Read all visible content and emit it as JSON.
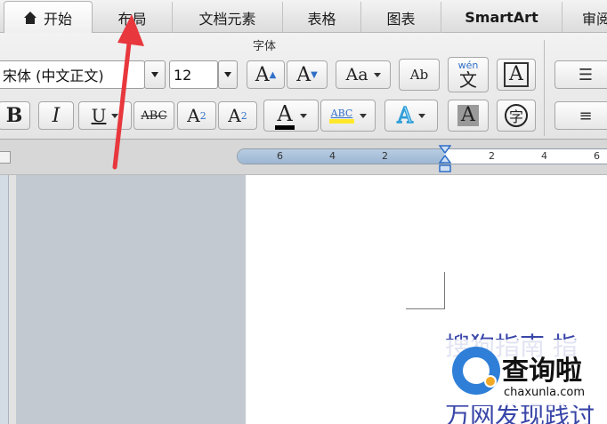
{
  "tabs": [
    {
      "label": "开始",
      "active": true
    },
    {
      "label": "布局"
    },
    {
      "label": "文档元素"
    },
    {
      "label": "表格"
    },
    {
      "label": "图表"
    },
    {
      "label": "SmartArt"
    },
    {
      "label": "审阅"
    }
  ],
  "ribbon": {
    "group_label": "字体",
    "font_name": "宋体 (中文正文)",
    "font_size": "12",
    "grow_font": "A",
    "shrink_font": "A",
    "change_case": "Aa",
    "clear_format": "Ab",
    "phonetic_top": "wén",
    "phonetic_char": "文",
    "char_border": "A",
    "bold": "B",
    "italic": "I",
    "underline": "U",
    "strike": "ABC",
    "super_base": "A",
    "super_mark": "2",
    "sub_base": "A",
    "sub_mark": "2",
    "font_color": "A",
    "highlight": "ABC",
    "text_effect": "A",
    "char_shading": "A",
    "enclose_char": "字"
  },
  "ruler": {
    "labels": [
      "6",
      "4",
      "2",
      "2",
      "4",
      "6"
    ]
  },
  "document": {
    "line1": "搜狗指南   指",
    "line2": "万网发现践讨"
  },
  "watermark": {
    "title": "查询啦",
    "url": "chaxunla.com"
  },
  "colors": {
    "accent": "#2f7fd8",
    "arrow": "#e8383d",
    "text_blue": "#3946a8"
  }
}
